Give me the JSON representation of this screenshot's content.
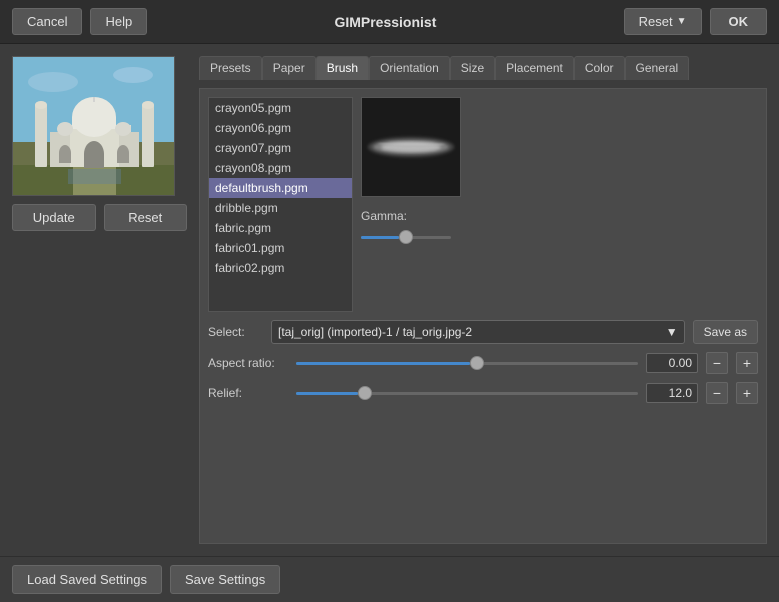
{
  "header": {
    "cancel_label": "Cancel",
    "help_label": "Help",
    "title": "GIMPressionist",
    "reset_label": "Reset",
    "ok_label": "OK"
  },
  "preview": {
    "update_label": "Update",
    "reset_label": "Reset"
  },
  "tabs": [
    {
      "label": "Presets",
      "active": false
    },
    {
      "label": "Paper",
      "active": false
    },
    {
      "label": "Brush",
      "active": true
    },
    {
      "label": "Orientation",
      "active": false
    },
    {
      "label": "Size",
      "active": false
    },
    {
      "label": "Placement",
      "active": false
    },
    {
      "label": "Color",
      "active": false
    },
    {
      "label": "General",
      "active": false
    }
  ],
  "brush_list": [
    {
      "name": "crayon05.pgm",
      "selected": false
    },
    {
      "name": "crayon06.pgm",
      "selected": false
    },
    {
      "name": "crayon07.pgm",
      "selected": false
    },
    {
      "name": "crayon08.pgm",
      "selected": false
    },
    {
      "name": "defaultbrush.pgm",
      "selected": true
    },
    {
      "name": "dribble.pgm",
      "selected": false
    },
    {
      "name": "fabric.pgm",
      "selected": false
    },
    {
      "name": "fabric01.pgm",
      "selected": false
    },
    {
      "name": "fabric02.pgm",
      "selected": false
    }
  ],
  "gamma": {
    "label": "Gamma:",
    "value": 50,
    "thumb_left": "42%"
  },
  "select": {
    "label": "Select:",
    "value": "[taj_orig] (imported)-1 / taj_orig.jpg-2",
    "save_as_label": "Save as"
  },
  "aspect_ratio": {
    "label": "Aspect ratio:",
    "value": "0.00",
    "thumb_left": "51%",
    "fill_width": "51%"
  },
  "relief": {
    "label": "Relief:",
    "value": "12.0",
    "thumb_left": "18%",
    "fill_width": "18%"
  },
  "footer": {
    "load_label": "Load Saved Settings",
    "save_label": "Save Settings"
  }
}
